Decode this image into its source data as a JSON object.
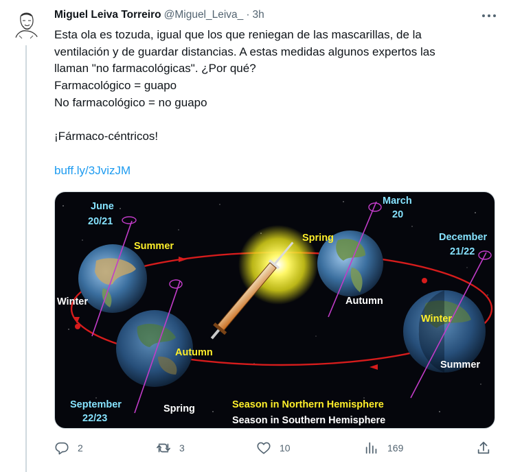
{
  "tweet": {
    "author_name": "Miguel Leiva Torreiro",
    "handle": "@Miguel_Leiva_",
    "separator": "·",
    "time": "3h",
    "lines": [
      "Esta ola es tozuda, igual que los que reniegan de las mascarillas, de la",
      "ventilación y de guardar distancias. A estas medidas algunos expertos las",
      "llaman \"no farmacológicas\". ¿Por qué?",
      "Farmacológico = guapo",
      "No farmacológico = no guapo",
      "",
      "¡Fármaco-céntricos!",
      ""
    ],
    "link": "buff.ly/3JvizJM"
  },
  "image": {
    "labels": {
      "june_month": "June",
      "june_day": "20/21",
      "march_month": "March",
      "march_day": "20",
      "december_month": "December",
      "december_day": "21/22",
      "september_month": "September",
      "september_day": "22/23",
      "summer_1": "Summer",
      "winter_1": "Winter",
      "autumn_1": "Autumn",
      "spring_1": "Spring",
      "spring_2": "Spring",
      "autumn_2": "Autumn",
      "winter_2": "Winter",
      "summer_2": "Summer",
      "legend_north": "Season in Northern Hemisphere",
      "legend_south": "Season in Southern Hemisphere"
    },
    "colors": {
      "yellow_label": "#ffef2a",
      "cyan_label": "#86e3ff",
      "orbit": "#d61c1c",
      "axis": "#c23cc9"
    }
  },
  "actions": {
    "reply_count": "2",
    "retweet_count": "3",
    "like_count": "10",
    "view_count": "169"
  }
}
